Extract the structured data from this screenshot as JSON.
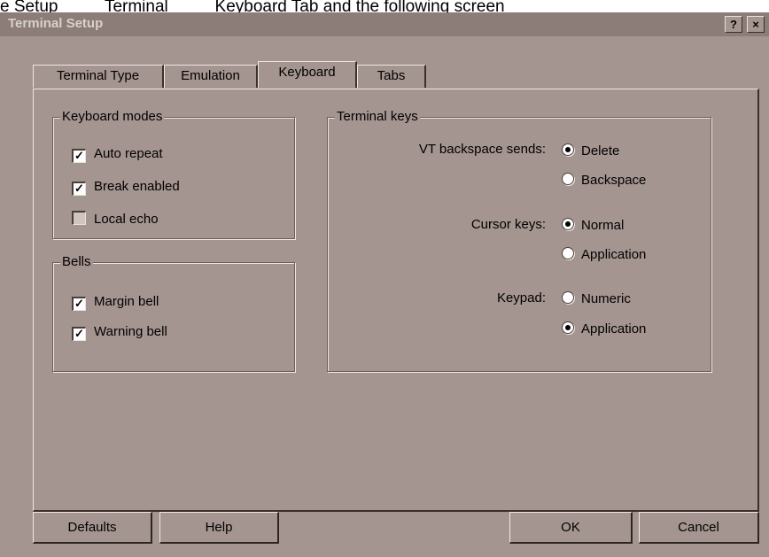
{
  "caption": "e Setup          Terminal          Keyboard Tab and the following screen",
  "window": {
    "title": "Terminal Setup",
    "help_button": "?",
    "close_button": "×"
  },
  "tabs": [
    {
      "label": "Terminal Type",
      "active": false
    },
    {
      "label": "Emulation",
      "active": false
    },
    {
      "label": "Keyboard",
      "active": true
    },
    {
      "label": "Tabs",
      "active": false
    }
  ],
  "keyboard_modes": {
    "legend": "Keyboard modes",
    "items": [
      {
        "label": "Auto repeat",
        "checked": true
      },
      {
        "label": "Break enabled",
        "checked": true
      },
      {
        "label": "Local echo",
        "checked": false
      }
    ]
  },
  "bells": {
    "legend": "Bells",
    "items": [
      {
        "label": "Margin bell",
        "checked": true
      },
      {
        "label": "Warning bell",
        "checked": true
      }
    ]
  },
  "terminal_keys": {
    "legend": "Terminal keys",
    "vt_backspace": {
      "label": "VT backspace sends:",
      "options": [
        {
          "label": "Delete",
          "selected": true
        },
        {
          "label": "Backspace",
          "selected": false
        }
      ]
    },
    "cursor_keys": {
      "label": "Cursor keys:",
      "options": [
        {
          "label": "Normal",
          "selected": true
        },
        {
          "label": "Application",
          "selected": false
        }
      ]
    },
    "keypad": {
      "label": "Keypad:",
      "options": [
        {
          "label": "Numeric",
          "selected": false
        },
        {
          "label": "Application",
          "selected": true
        }
      ]
    }
  },
  "buttons": {
    "defaults": "Defaults",
    "help": "Help",
    "ok": "OK",
    "cancel": "Cancel"
  },
  "colors": {
    "dialog_bg": "#a59590",
    "titlebar_bg": "#8c7d78"
  }
}
